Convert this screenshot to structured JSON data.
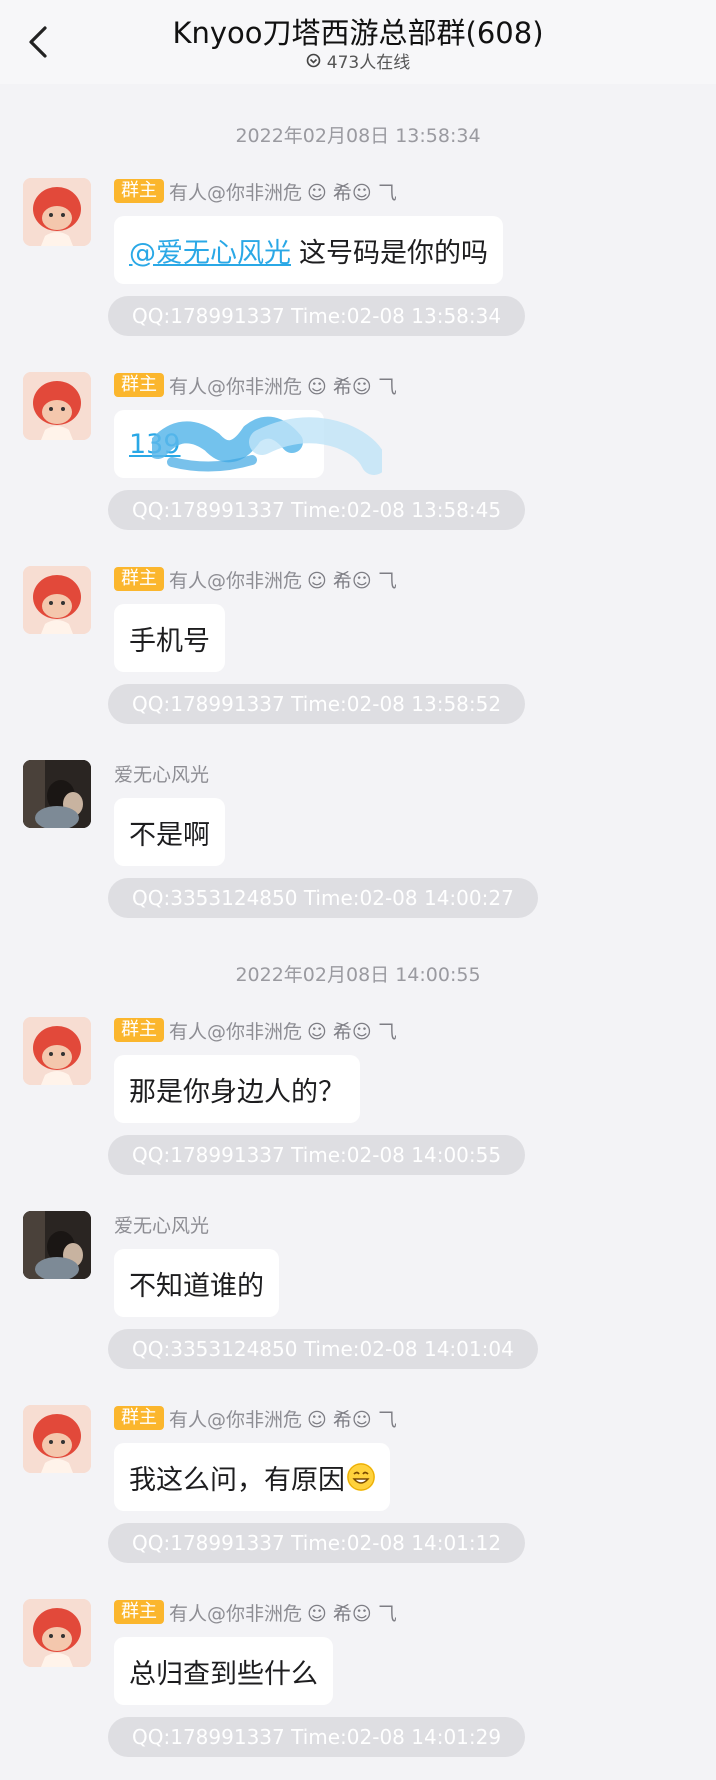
{
  "header": {
    "title": "Knyoo刀塔西游总部群(608)",
    "online": "473人在线"
  },
  "timestamps": [
    "2022年02月08日 13:58:34",
    "2022年02月08日 14:00:55"
  ],
  "host": {
    "badge": "群主",
    "name": "有人@你非洲危",
    "name_deco": "☺ 希☺ ⺄"
  },
  "user": {
    "name": "爱无心风光"
  },
  "messages": [
    {
      "mention": "@爱无心风光",
      "text": "这号码是你的吗",
      "meta": "QQ:178991337  Time:02-08 13:58:34"
    },
    {
      "number": "139",
      "meta": "QQ:178991337  Time:02-08 13:58:45"
    },
    {
      "text": "手机号",
      "meta": "QQ:178991337  Time:02-08 13:58:52"
    },
    {
      "text": "不是啊",
      "meta": "QQ:3353124850  Time:02-08 14:00:27"
    },
    {
      "text": "那是你身边人的？",
      "meta": "QQ:178991337  Time:02-08 14:00:55"
    },
    {
      "text": "不知道谁的",
      "meta": "QQ:3353124850  Time:02-08 14:01:04"
    },
    {
      "text": "我这么问，有原因",
      "meta": "QQ:178991337  Time:02-08 14:01:12"
    },
    {
      "text": "总归查到些什么",
      "meta": "QQ:178991337  Time:02-08 14:01:29"
    }
  ],
  "colors": {
    "background": "#f3f3f6",
    "badge": "#fbb62d",
    "link": "#2aa8e6",
    "meta_pill": "#dedee2"
  },
  "icons": {
    "back": "chevron-left-icon",
    "online": "online-status-icon",
    "emoji": "grinning-emoji-icon"
  }
}
